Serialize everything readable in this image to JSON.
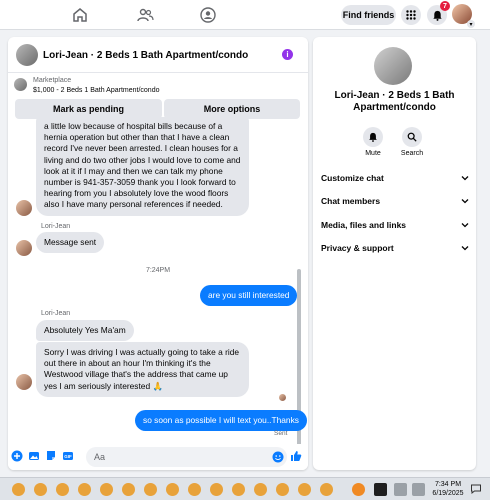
{
  "topnav": {
    "find_friends": "Find friends",
    "notification_count": "7"
  },
  "chat": {
    "title": "Lori-Jean · 2 Beds 1 Bath Apartment/condo",
    "marketplace_label": "Marketplace",
    "listing": "$1,000 - 2 Beds 1 Bath Apartment/condo",
    "mark_pending": "Mark as pending",
    "more_options": "More options",
    "messages": [
      {
        "text": "a little low because of hospital bills because of a hernia operation but other than that I have a clean record I've never been arrested. I clean houses for a living and do two other jobs I would love to come and look at it if I may and then we can talk my phone number is 941-357-3059 thank you I look forward to hearing from you I absolutely love the wood floors also I have many personal references if needed."
      },
      {
        "sender": "Lori-Jean",
        "text": "Message sent"
      },
      {
        "time": "7:24PM"
      },
      {
        "text": "are you still interested"
      },
      {
        "sender": "Lori-Jean",
        "text": "Absolutely Yes Ma'am"
      },
      {
        "text": "Sorry I was driving I was actually going to take a ride out there in about an hour I'm thinking it's the Westwood village that's the address that came up yes I am seriously interested 🙏"
      },
      {
        "text": "so soon as possible I will text you..Thanks",
        "status": "Sent"
      }
    ],
    "composer_placeholder": "Aa"
  },
  "profile": {
    "name": "Lori-Jean · 2 Beds 1 Bath Apartment/condo",
    "actions": [
      {
        "label": "Mute",
        "icon": "bell-icon"
      },
      {
        "label": "Search",
        "icon": "search-icon"
      }
    ],
    "sections": [
      {
        "label": "Customize chat"
      },
      {
        "label": "Chat members"
      },
      {
        "label": "Media, files and links"
      },
      {
        "label": "Privacy & support"
      }
    ]
  },
  "taskbar": {
    "time": "7:34 PM",
    "date": "6/19/2025"
  },
  "colors": {
    "accent": "#0a7cff",
    "badge": "#e41e3f",
    "info": "#9333ea"
  }
}
